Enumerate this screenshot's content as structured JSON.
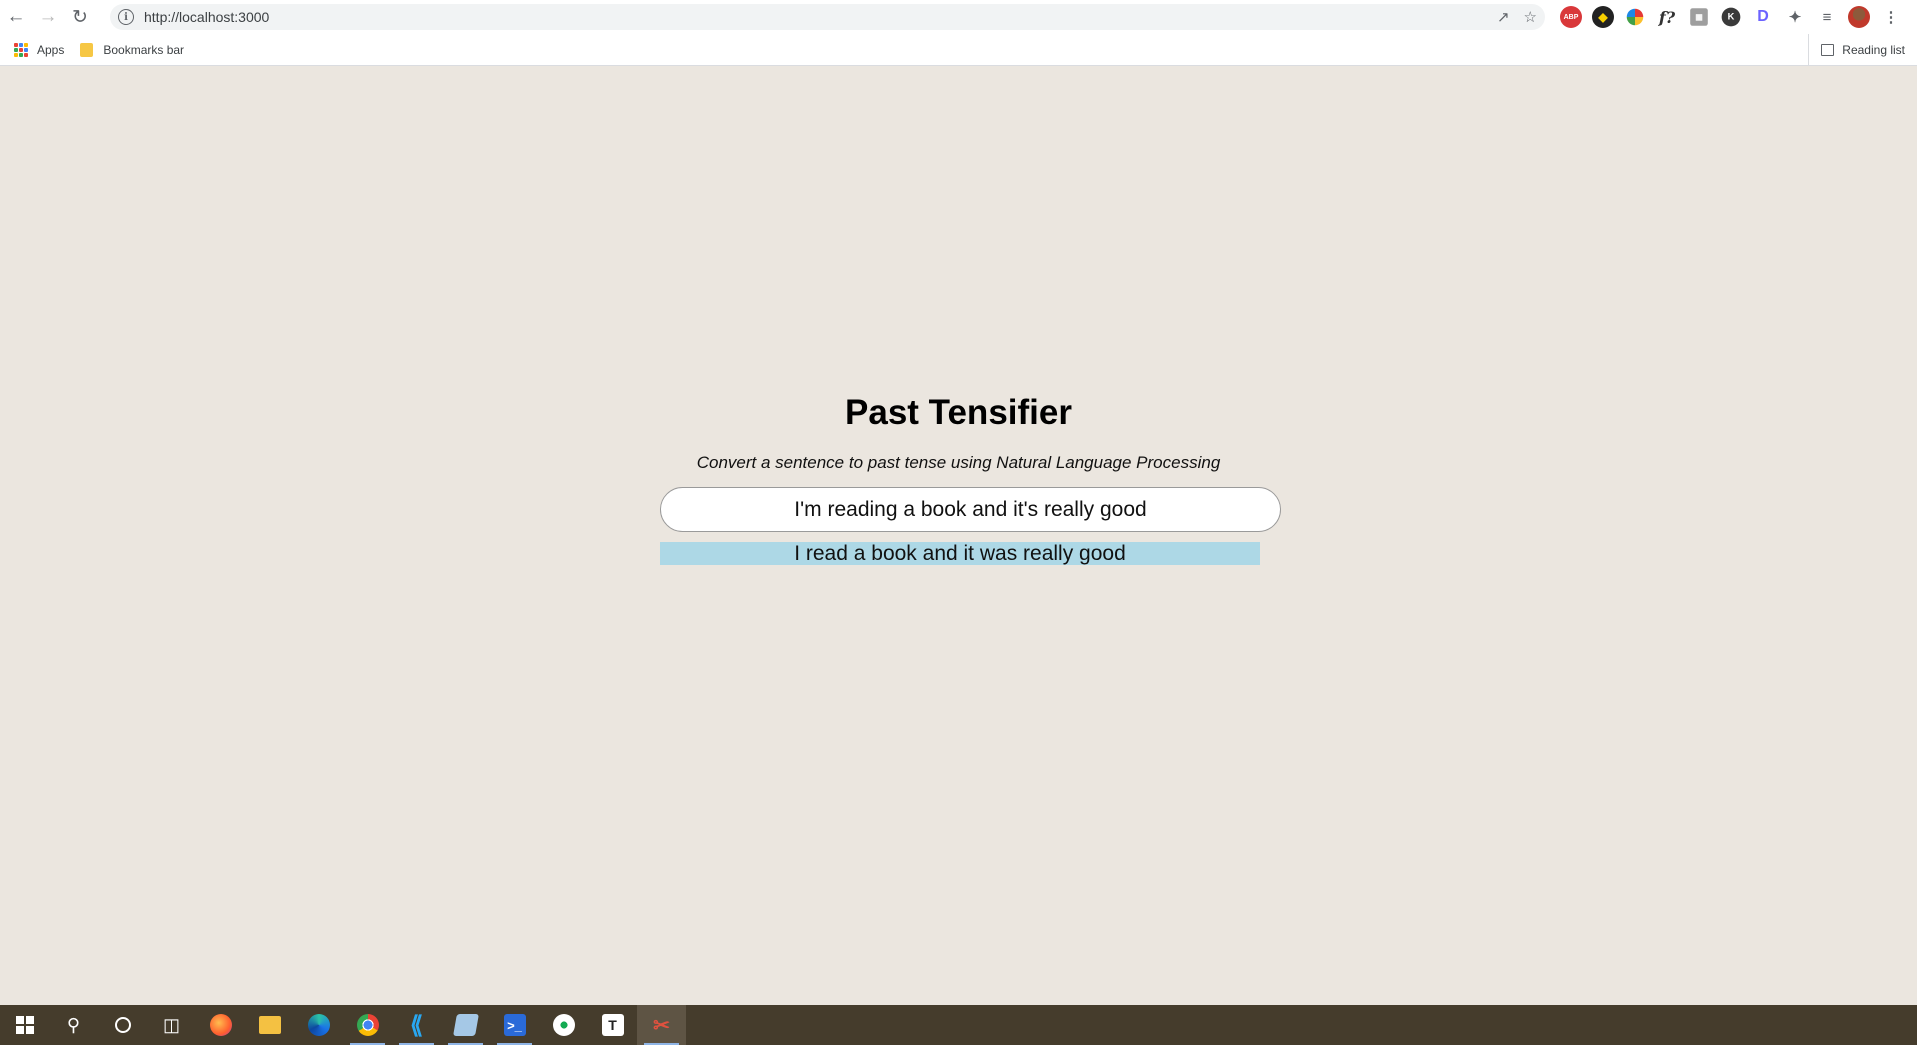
{
  "browser": {
    "url": "http://localhost:3000",
    "bookmarks": {
      "apps_label": "Apps",
      "folder_label": "Bookmarks bar",
      "reading_list_label": "Reading list"
    },
    "extensions": {
      "abp_label": "ABP",
      "font_label": "f?",
      "k_label": "K",
      "d_label": "D"
    }
  },
  "page": {
    "title": "Past Tensifier",
    "subtitle": "Convert a sentence to past tense using Natural Language Processing",
    "input_value": "I'm reading a book and it's really good",
    "output_text": "I read a book and it was really good"
  },
  "taskbar": {
    "typora_label": "T"
  },
  "colors": {
    "page_bg": "#ebe6df",
    "output_bg": "#add8e6",
    "taskbar_bg": "#453c2c"
  }
}
